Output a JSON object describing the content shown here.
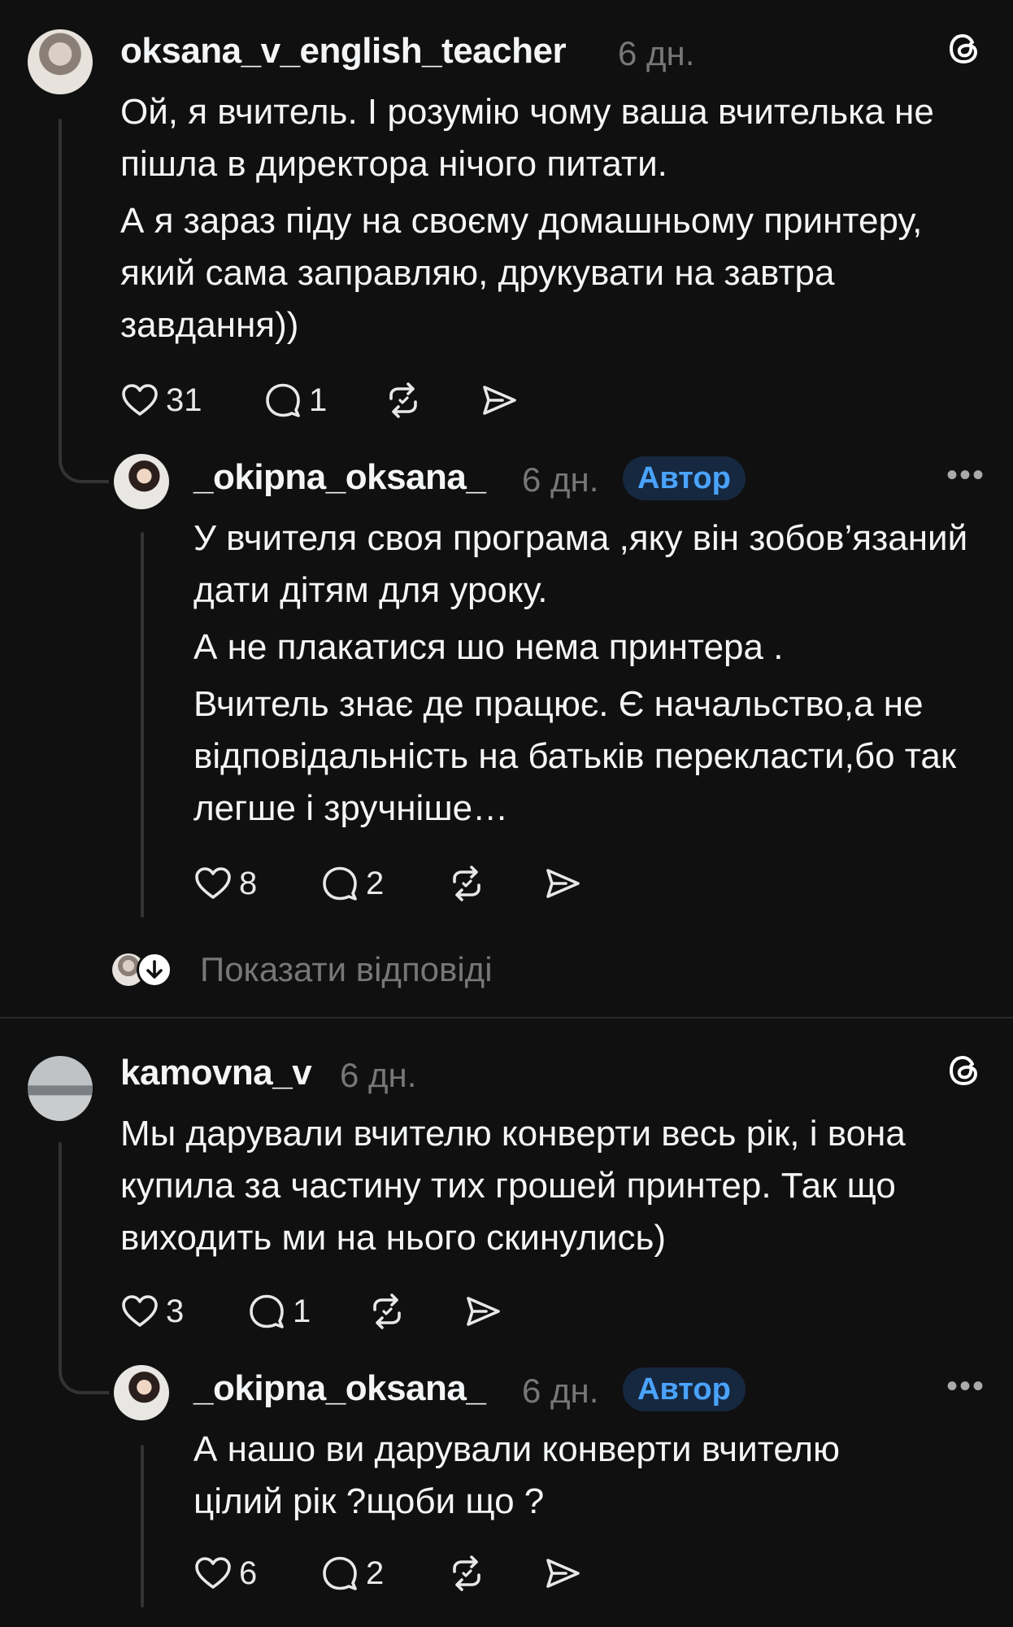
{
  "thread1": {
    "comment": {
      "username": "oksana_v_english_teacher",
      "time": "6 дн.",
      "text": [
        "Ой, я вчитель. І розумію чому ваша вчителька не пішла в директора нічого питати.",
        "А я зараз піду на своєму домашньому принтеру, який сама заправляю, друкувати на завтра завдання))"
      ],
      "likes": "31",
      "replies": "1"
    },
    "reply": {
      "username": "_okipna_oksana_",
      "time": "6 дн.",
      "badge": "Автор",
      "text": [
        "У вчителя своя програма ,яку він зобов’язаний дати дітям для уроку.",
        "А не плакатися шо нема принтера .",
        "Вчитель знає де працює. Є начальство,а не відповідальність на батьків перекласти,бо так легше і зручніше…"
      ],
      "likes": "8",
      "replies": "2"
    },
    "show_replies": "Показати відповіді"
  },
  "thread2": {
    "comment": {
      "username": "kamovna_v",
      "time": "6 дн.",
      "text": [
        "Мы дарували вчителю конверти весь рік, і вона купила за частину тих грошей принтер. Так що виходить ми на нього скинулись)"
      ],
      "likes": "3",
      "replies": "1"
    },
    "reply": {
      "username": "_okipna_oksana_",
      "time": "6 дн.",
      "badge": "Автор",
      "text": [
        "А нашо ви дарували конверти вчителю цілий рік ?щоби що ?"
      ],
      "likes": "6",
      "replies": "2"
    }
  },
  "icons": [
    "threads-logo-icon",
    "heart-icon",
    "comment-icon",
    "repost-icon",
    "share-icon",
    "more-icon",
    "arrow-down-icon"
  ],
  "colors": {
    "background": "#101010",
    "text": "#f3f5f7",
    "muted": "#777777",
    "badge_text": "#4aa3ff",
    "badge_bg": "#16283f"
  }
}
